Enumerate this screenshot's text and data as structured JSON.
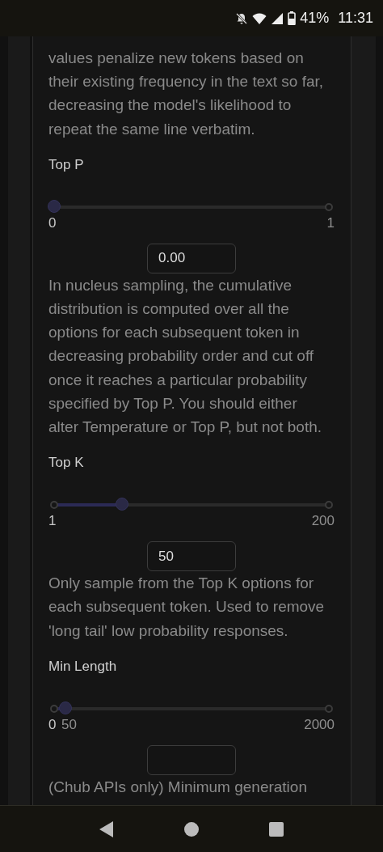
{
  "status_bar": {
    "battery": "41%",
    "time": "11:31"
  },
  "sections": [
    {
      "description": "values penalize new tokens based on their existing frequency in the text so far, decreasing the model's likelihood to repeat the same line verbatim."
    },
    {
      "label": "Top P",
      "slider": {
        "min_label": "0",
        "max_label": "1",
        "level": 0
      },
      "input": {
        "value": "0.00"
      },
      "description": "In nucleus sampling, the cumulative distribution is computed over all the options for each subsequent token in decreasing probability order and cut off once it reaches a particular probability specified by Top P. You should either alter Temperature or Top P, but not both."
    },
    {
      "label": "Top K",
      "slider": {
        "min_label": "1",
        "max_label": "200",
        "level": 0.246
      },
      "input": {
        "value": "50"
      },
      "description": "Only sample from the Top K options for each subsequent token. Used to remove 'long tail' low probability responses."
    },
    {
      "label": "Min Length",
      "slider": {
        "min_label": "0",
        "extra_label": "50",
        "max_label": "2000",
        "level": 0.04
      },
      "input": {
        "kind": "text"
      },
      "description": "(Chub APIs only) Minimum generation"
    }
  ]
}
